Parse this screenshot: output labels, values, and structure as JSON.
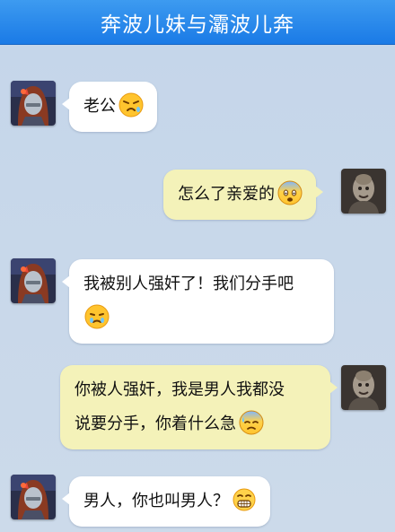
{
  "header": {
    "title": "奔波儿妹与灞波儿奔"
  },
  "messages": [
    {
      "sender": "female",
      "direction": "in",
      "text": "老公",
      "emoji": "pouting-face-icon"
    },
    {
      "sender": "male",
      "direction": "out",
      "text": "怎么了亲爱的",
      "emoji": "fearful-face-icon"
    },
    {
      "sender": "female",
      "direction": "in",
      "text": "我被别人强奸了！我们分手吧",
      "emoji": "crying-face-icon"
    },
    {
      "sender": "male",
      "direction": "out",
      "text_line1": "你被人强奸，我是男人我都没",
      "text_line2": "说要分手，你着什么急",
      "emoji": "cold-sweat-face-icon"
    },
    {
      "sender": "female",
      "direction": "in",
      "text": "男人，你也叫男人？",
      "emoji": "grinning-teeth-face-icon"
    }
  ],
  "colors": {
    "header_bg": "#1a7ae6",
    "chat_bg": "#c9d8ea",
    "incoming_bubble": "#ffffff",
    "outgoing_bubble": "#f4f2b9"
  }
}
